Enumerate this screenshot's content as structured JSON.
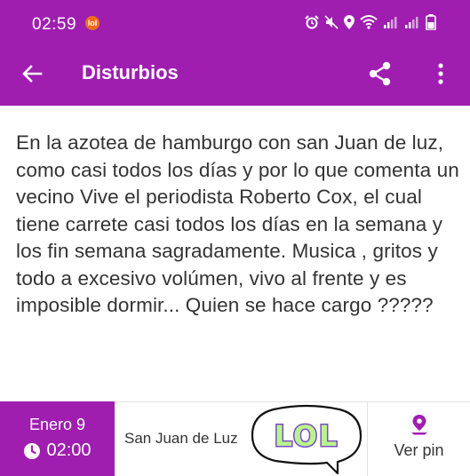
{
  "status_bar": {
    "time": "02:59",
    "notification_badge": "lol"
  },
  "toolbar": {
    "title": "Disturbios"
  },
  "report": {
    "text": "En la azotea de hamburgo con san Juan de luz,  como casi todos los días y por lo que comenta un vecino Vive el periodista Roberto Cox, el cual tiene carrete casi todos los días en la semana y los fin semana sagradamente.  Musica , gritos y todo a excesivo volúmen,  vivo al frente y es imposible dormir...  Quien se hace cargo ?????"
  },
  "footer": {
    "date": "Enero 9",
    "hour": "02:00",
    "place": "San Juan de Luz",
    "pin_label": "Ver pin"
  },
  "sticker": {
    "text": "LOL"
  },
  "colors": {
    "primary": "#9f1eb0",
    "text": "#333333",
    "sticker_fill": "#b9f38f",
    "sticker_purple": "#7b4cc4"
  }
}
